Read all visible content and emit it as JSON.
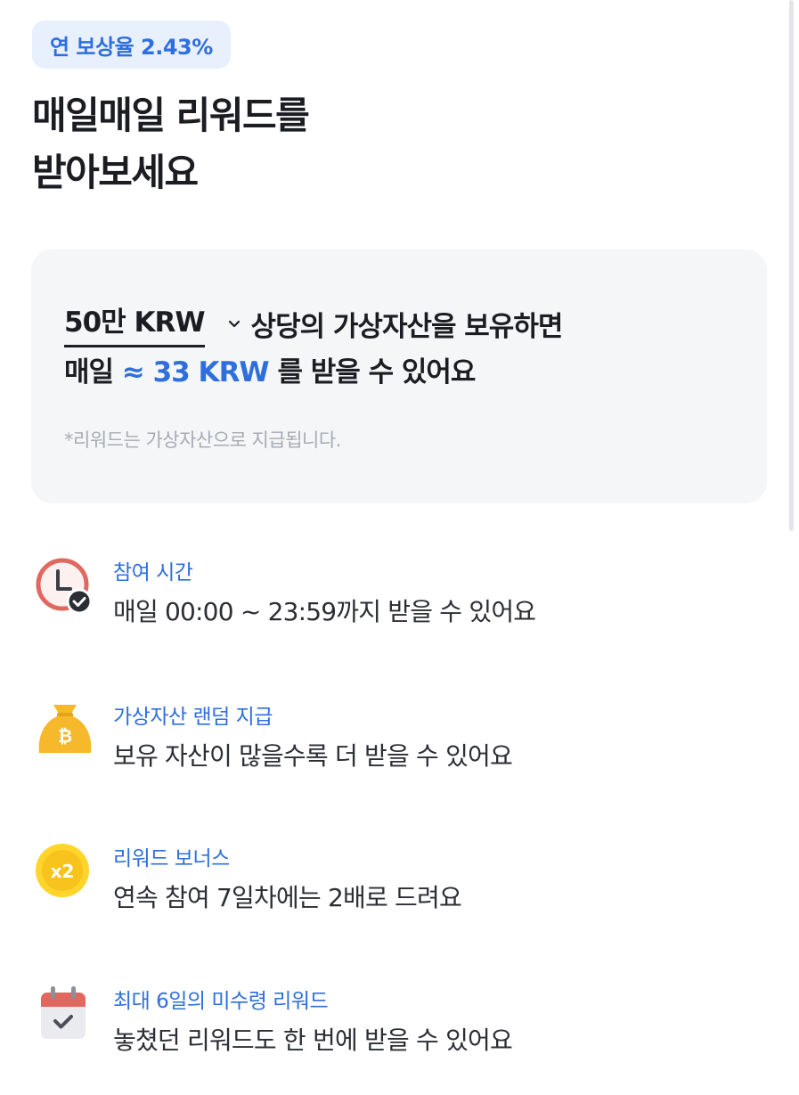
{
  "badge": {
    "label": "연 보상율 2.43%"
  },
  "headline": {
    "line1": "매일매일 리워드를",
    "line2": "받아보세요"
  },
  "card": {
    "amount_value": "50만 KRW",
    "line1_suffix": "상당의 가상자산을 보유하면",
    "line2_prefix": "매일",
    "line2_reward": "≈ 33 KRW",
    "line2_suffix": "를 받을 수 있어요",
    "note": "*리워드는 가상자산으로 지급됩니다."
  },
  "features": [
    {
      "icon": "clock-check-icon",
      "title": "참여 시간",
      "desc": "매일 00:00 ~ 23:59까지 받을 수 있어요"
    },
    {
      "icon": "coin-bag-icon",
      "title": "가상자산 랜덤 지급",
      "desc": "보유 자산이 많을수록 더 받을 수 있어요"
    },
    {
      "icon": "x2-coin-icon",
      "title": "리워드 보너스",
      "desc": "연속 참여 7일차에는 2배로 드려요",
      "icon_text": "x2"
    },
    {
      "icon": "calendar-check-icon",
      "title": "최대 6일의 미수령 리워드",
      "desc": "놓쳤던 리워드도 한 번에 받을 수 있어요"
    }
  ],
  "colors": {
    "accent": "#2f6fdc",
    "badge_bg": "#e8f0fd",
    "card_bg": "#f5f6f8",
    "clock_red": "#e0685f",
    "coin_yellow": "#f6b92b"
  }
}
